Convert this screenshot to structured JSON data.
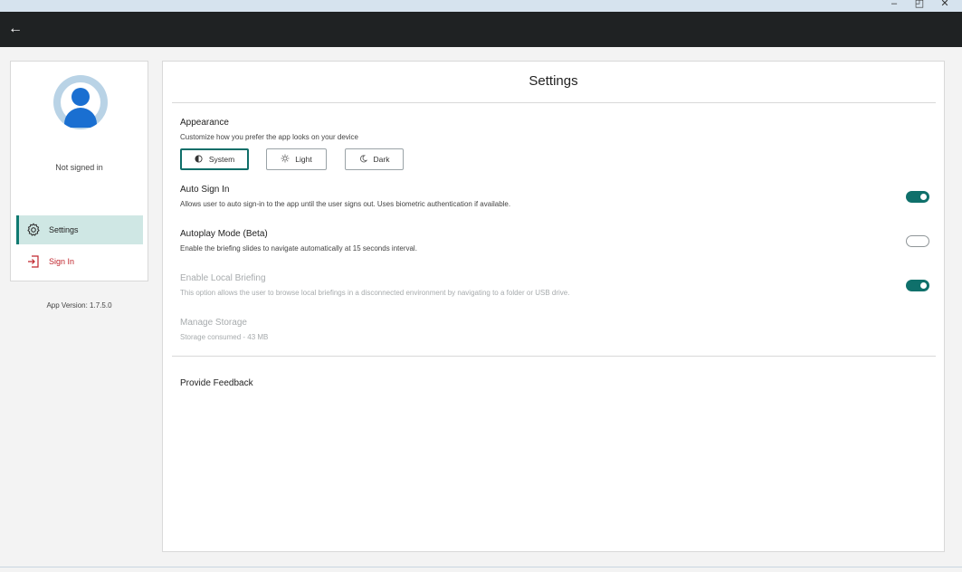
{
  "window": {
    "minimize": "–",
    "maximize": "◰",
    "close": "✕"
  },
  "appbar": {
    "back": "←"
  },
  "sidebar": {
    "status": "Not signed in",
    "items": [
      {
        "label": "Settings",
        "icon": "gear-icon",
        "selected": true
      },
      {
        "label": "Sign In",
        "icon": "sign-in-icon",
        "selected": false
      }
    ],
    "version": "App Version: 1.7.5.0"
  },
  "settings": {
    "title": "Settings",
    "appearance": {
      "title": "Appearance",
      "description": "Customize how you prefer the app looks on your device",
      "options": [
        {
          "label": "System",
          "icon": "half-circle-icon",
          "selected": true
        },
        {
          "label": "Light",
          "icon": "sun-icon",
          "selected": false
        },
        {
          "label": "Dark",
          "icon": "moon-icon",
          "selected": false
        }
      ]
    },
    "auto_sign_in": {
      "title": "Auto Sign In",
      "description": "Allows user to auto sign-in to the app until the user signs out. Uses biometric authentication if available.",
      "enabled": true
    },
    "autoplay": {
      "title": "Autoplay Mode (Beta)",
      "description": "Enable the briefing slides to navigate automatically at 15 seconds interval.",
      "enabled": false
    },
    "local_briefing": {
      "title": "Enable Local Briefing",
      "description": "This option allows the user to browse local briefings in a disconnected environment by navigating to a folder or USB drive.",
      "enabled": true,
      "disabled": true
    },
    "storage": {
      "title": "Manage Storage",
      "description": "Storage consumed - 43 MB"
    },
    "feedback": {
      "title": "Provide Feedback"
    }
  },
  "colors": {
    "accent": "#0f706b",
    "selected_nav": "#cfe7e4",
    "sign_in": "#c0262d",
    "appbar": "#1f2223"
  }
}
